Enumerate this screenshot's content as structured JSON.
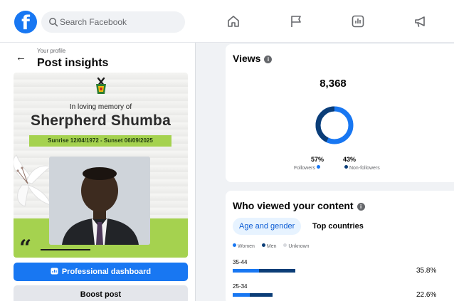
{
  "topbar": {
    "logo_letter": "f",
    "search_placeholder": "Search Facebook",
    "nav_icons": [
      "home-icon",
      "flag-icon",
      "ads-manager-icon",
      "megaphone-icon"
    ]
  },
  "left_panel": {
    "back_label": "←",
    "subtitle": "Your profile",
    "title": "Post insights",
    "post": {
      "memory_line": "In loving memory of",
      "name": "Sherpherd Shumba",
      "dates": "Sunrise 12/04/1972 - Sunset 06/09/2025",
      "quote_mark": "“"
    },
    "primary_button": "Professional dashboard",
    "secondary_button": "Boost post"
  },
  "views": {
    "title": "Views",
    "total": "8,368",
    "followers_pct": "57%",
    "followers_label": "Followers",
    "nonfollowers_pct": "43%",
    "nonfollowers_label": "Non-followers",
    "followers_fraction": 0.57
  },
  "who_viewed": {
    "title": "Who viewed your content",
    "tabs": [
      "Age and gender",
      "Top countries"
    ],
    "legend": [
      "Women",
      "Men",
      "Unknown"
    ],
    "rows": [
      {
        "age": "35-44",
        "pct": "35.8%",
        "women_fraction": 0.42,
        "men_fraction": 0.58,
        "total_fraction": 0.358
      },
      {
        "age": "25-34",
        "pct": "22.6%",
        "women_fraction": 0.44,
        "men_fraction": 0.56,
        "total_fraction": 0.226
      }
    ]
  },
  "colors": {
    "brand": "#1877f2",
    "dark_blue": "#0b3d77",
    "light_gray": "#d8dadf",
    "memorial_green": "#a5d24f"
  }
}
